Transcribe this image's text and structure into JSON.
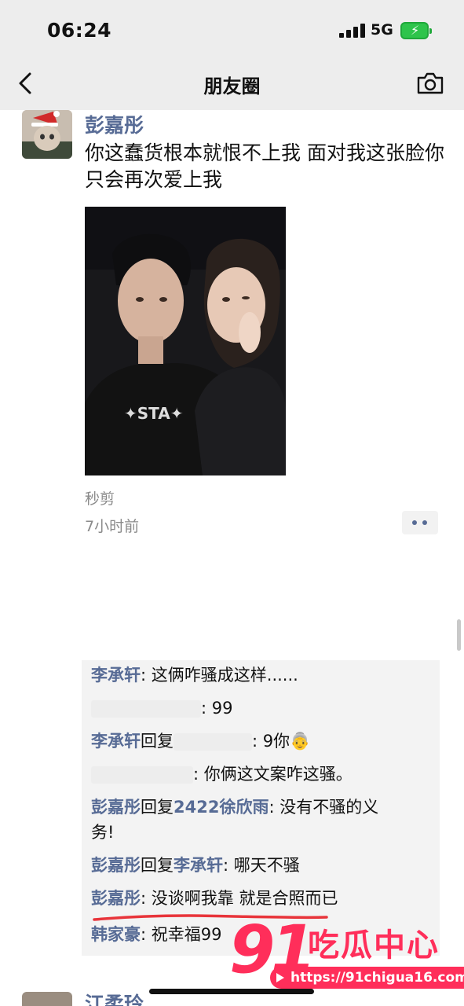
{
  "status_bar": {
    "time": "06:24",
    "network": "5G",
    "battery_icon": "battery-charging-icon"
  },
  "nav": {
    "title": "朋友圈",
    "back_icon": "chevron-left-icon",
    "camera_icon": "camera-icon"
  },
  "post": {
    "author": "彭嘉彤",
    "text": "你这蠢货根本就恨不上我 面对我这张脸你只会再次爱上我",
    "source": "秒剪",
    "time_ago": "7小时前",
    "more_icon": "more-dots-icon"
  },
  "comments": [
    {
      "name": "李承轩",
      "sep": ": ",
      "text": "这俩咋骚成这样......"
    },
    {
      "text": ": 99"
    },
    {
      "name": "李承轩",
      "reply_word": "回复",
      "text": ": 9你👵"
    },
    {
      "text": ": 你俩这文案咋这骚。"
    },
    {
      "name": "彭嘉彤",
      "reply_word": "回复",
      "target": "2422徐欣雨",
      "text": ": 没有不骚的义",
      "text2": "务!"
    },
    {
      "name": "彭嘉彤",
      "reply_word": "回复",
      "target": "李承轩",
      "text": ": 哪天不骚"
    },
    {
      "name": "彭嘉彤",
      "sep": ": ",
      "text": "没谈啊我靠 就是合照而已"
    },
    {
      "name": "韩家豪",
      "sep": ": ",
      "text": "祝幸福99"
    }
  ],
  "watermark": {
    "number": "91",
    "label": "吃瓜中心",
    "url": "https://91chigua16.com"
  },
  "next_post": {
    "author": "江柔玲"
  },
  "colors": {
    "name_blue": "#576b95",
    "bar_bg": "#ededed",
    "comment_bg": "#f3f3f3",
    "watermark_pink": "#ff2e5a",
    "underline_red": "#e8343a"
  }
}
